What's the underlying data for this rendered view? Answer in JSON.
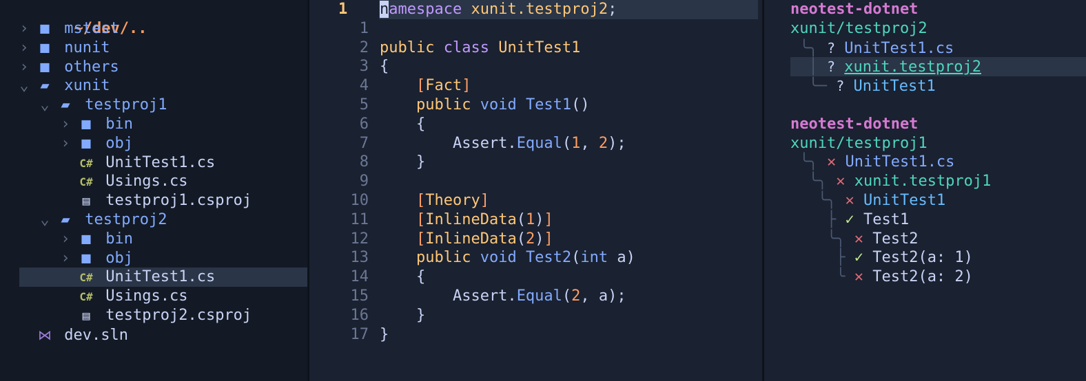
{
  "file_tree": {
    "root_path": "~/dev/..",
    "rows": [
      {
        "indent": 0,
        "chevron": "›",
        "icon": "folder",
        "label": "mstest",
        "kind": "dir"
      },
      {
        "indent": 0,
        "chevron": "›",
        "icon": "folder",
        "label": "nunit",
        "kind": "dir"
      },
      {
        "indent": 0,
        "chevron": "›",
        "icon": "folder",
        "label": "others",
        "kind": "dir"
      },
      {
        "indent": 0,
        "chevron": "⌄",
        "icon": "folder-open",
        "label": "xunit",
        "kind": "dir"
      },
      {
        "indent": 1,
        "chevron": "⌄",
        "icon": "folder-open",
        "label": "testproj1",
        "kind": "dir"
      },
      {
        "indent": 2,
        "chevron": "›",
        "icon": "folder",
        "label": "bin",
        "kind": "dir"
      },
      {
        "indent": 2,
        "chevron": "›",
        "icon": "folder",
        "label": "obj",
        "kind": "dir"
      },
      {
        "indent": 2,
        "chevron": "",
        "icon": "csharp",
        "label": "UnitTest1.cs",
        "kind": "file"
      },
      {
        "indent": 2,
        "chevron": "",
        "icon": "csharp",
        "label": "Usings.cs",
        "kind": "file"
      },
      {
        "indent": 2,
        "chevron": "",
        "icon": "document",
        "label": "testproj1.csproj",
        "kind": "file"
      },
      {
        "indent": 1,
        "chevron": "⌄",
        "icon": "folder-open",
        "label": "testproj2",
        "kind": "dir"
      },
      {
        "indent": 2,
        "chevron": "›",
        "icon": "folder",
        "label": "bin",
        "kind": "dir"
      },
      {
        "indent": 2,
        "chevron": "›",
        "icon": "folder",
        "label": "obj",
        "kind": "dir"
      },
      {
        "indent": 2,
        "chevron": "",
        "icon": "csharp",
        "label": "UnitTest1.cs",
        "kind": "file",
        "selected": true
      },
      {
        "indent": 2,
        "chevron": "",
        "icon": "csharp",
        "label": "Usings.cs",
        "kind": "file"
      },
      {
        "indent": 2,
        "chevron": "",
        "icon": "document",
        "label": "testproj2.csproj",
        "kind": "file"
      },
      {
        "indent": 0,
        "chevron": "",
        "icon": "visual-studio",
        "label": "dev.sln",
        "kind": "file"
      }
    ]
  },
  "editor": {
    "current_line": "1",
    "lines": [
      {
        "num": "1",
        "current": true,
        "tokens": [
          [
            "cur-char",
            "n"
          ],
          [
            "kw",
            "amespace "
          ],
          [
            "ty",
            "xunit.testproj2"
          ],
          [
            "txt",
            ";"
          ]
        ]
      },
      {
        "num": "1",
        "tokens": []
      },
      {
        "num": "2",
        "tokens": [
          [
            "ty",
            "public "
          ],
          [
            "kw",
            "class "
          ],
          [
            "ty",
            "UnitTest1"
          ]
        ]
      },
      {
        "num": "3",
        "tokens": [
          [
            "txt",
            "{"
          ]
        ]
      },
      {
        "num": "4",
        "tokens": [
          [
            "txt",
            "    "
          ],
          [
            "br",
            "["
          ],
          [
            "attr",
            "Fact"
          ],
          [
            "br",
            "]"
          ]
        ]
      },
      {
        "num": "5",
        "tokens": [
          [
            "txt",
            "    "
          ],
          [
            "ty",
            "public "
          ],
          [
            "fn",
            "void "
          ],
          [
            "fn",
            "Test1"
          ],
          [
            "txt",
            "()"
          ]
        ]
      },
      {
        "num": "6",
        "tokens": [
          [
            "txt",
            "    {"
          ]
        ]
      },
      {
        "num": "7",
        "tokens": [
          [
            "txt",
            "        Assert."
          ],
          [
            "fn",
            "Equal"
          ],
          [
            "txt",
            "("
          ],
          [
            "num",
            "1"
          ],
          [
            "txt",
            ", "
          ],
          [
            "num",
            "2"
          ],
          [
            "txt",
            ");"
          ]
        ]
      },
      {
        "num": "8",
        "tokens": [
          [
            "txt",
            "    }"
          ]
        ]
      },
      {
        "num": "9",
        "tokens": []
      },
      {
        "num": "10",
        "tokens": [
          [
            "txt",
            "    "
          ],
          [
            "br",
            "["
          ],
          [
            "attr",
            "Theory"
          ],
          [
            "br",
            "]"
          ]
        ]
      },
      {
        "num": "11",
        "tokens": [
          [
            "txt",
            "    "
          ],
          [
            "br",
            "["
          ],
          [
            "attr",
            "InlineData"
          ],
          [
            "txt",
            "("
          ],
          [
            "num",
            "1"
          ],
          [
            "txt",
            ")"
          ],
          [
            "br",
            "]"
          ]
        ]
      },
      {
        "num": "12",
        "tokens": [
          [
            "txt",
            "    "
          ],
          [
            "br",
            "["
          ],
          [
            "attr",
            "InlineData"
          ],
          [
            "txt",
            "("
          ],
          [
            "num",
            "2"
          ],
          [
            "txt",
            ")"
          ],
          [
            "br",
            "]"
          ]
        ]
      },
      {
        "num": "13",
        "tokens": [
          [
            "txt",
            "    "
          ],
          [
            "ty",
            "public "
          ],
          [
            "fn",
            "void "
          ],
          [
            "fn",
            "Test2"
          ],
          [
            "txt",
            "("
          ],
          [
            "fn",
            "int "
          ],
          [
            "txt",
            "a)"
          ]
        ]
      },
      {
        "num": "14",
        "tokens": [
          [
            "txt",
            "    {"
          ]
        ]
      },
      {
        "num": "15",
        "tokens": [
          [
            "txt",
            "        Assert."
          ],
          [
            "fn",
            "Equal"
          ],
          [
            "txt",
            "("
          ],
          [
            "num",
            "2"
          ],
          [
            "txt",
            ", a);"
          ]
        ]
      },
      {
        "num": "16",
        "tokens": [
          [
            "txt",
            "    }"
          ]
        ]
      },
      {
        "num": "17",
        "tokens": [
          [
            "txt",
            "}"
          ]
        ]
      }
    ]
  },
  "summary": {
    "rows": [
      {
        "type": "adapter",
        "text": "neotest-dotnet"
      },
      {
        "type": "project",
        "text": "xunit/testproj2"
      },
      {
        "type": "node",
        "tree": " ╰╮ ",
        "status": "unknown",
        "glyph": "?",
        "kind": "file",
        "text": "UnitTest1.cs"
      },
      {
        "type": "node",
        "tree": "  │ ",
        "status": "unknown",
        "glyph": "?",
        "kind": "ns",
        "text": "xunit.testproj2",
        "focused": true
      },
      {
        "type": "node",
        "tree": "  ╰─ ",
        "status": "unknown",
        "glyph": "?",
        "kind": "cls",
        "text": "UnitTest1"
      },
      {
        "type": "blank",
        "text": ""
      },
      {
        "type": "adapter",
        "text": "neotest-dotnet"
      },
      {
        "type": "project",
        "text": "xunit/testproj1"
      },
      {
        "type": "node",
        "tree": " ╰╮ ",
        "status": "failed",
        "glyph": "✕",
        "kind": "file",
        "text": "UnitTest1.cs"
      },
      {
        "type": "node",
        "tree": "  ╰╮ ",
        "status": "failed",
        "glyph": "✕",
        "kind": "ns",
        "text": "xunit.testproj1"
      },
      {
        "type": "node",
        "tree": "   ╰╮ ",
        "status": "failed",
        "glyph": "✕",
        "kind": "cls",
        "text": "UnitTest1"
      },
      {
        "type": "node",
        "tree": "    ├ ",
        "status": "passed",
        "glyph": "✓",
        "kind": "test",
        "text": "Test1"
      },
      {
        "type": "node",
        "tree": "    ╰╮ ",
        "status": "failed",
        "glyph": "✕",
        "kind": "test",
        "text": "Test2"
      },
      {
        "type": "node",
        "tree": "     ├ ",
        "status": "passed",
        "glyph": "✓",
        "kind": "test",
        "text": "Test2(a: 1)"
      },
      {
        "type": "node",
        "tree": "     ╰ ",
        "status": "failed",
        "glyph": "✕",
        "kind": "test",
        "text": "Test2(a: 2)"
      }
    ]
  }
}
